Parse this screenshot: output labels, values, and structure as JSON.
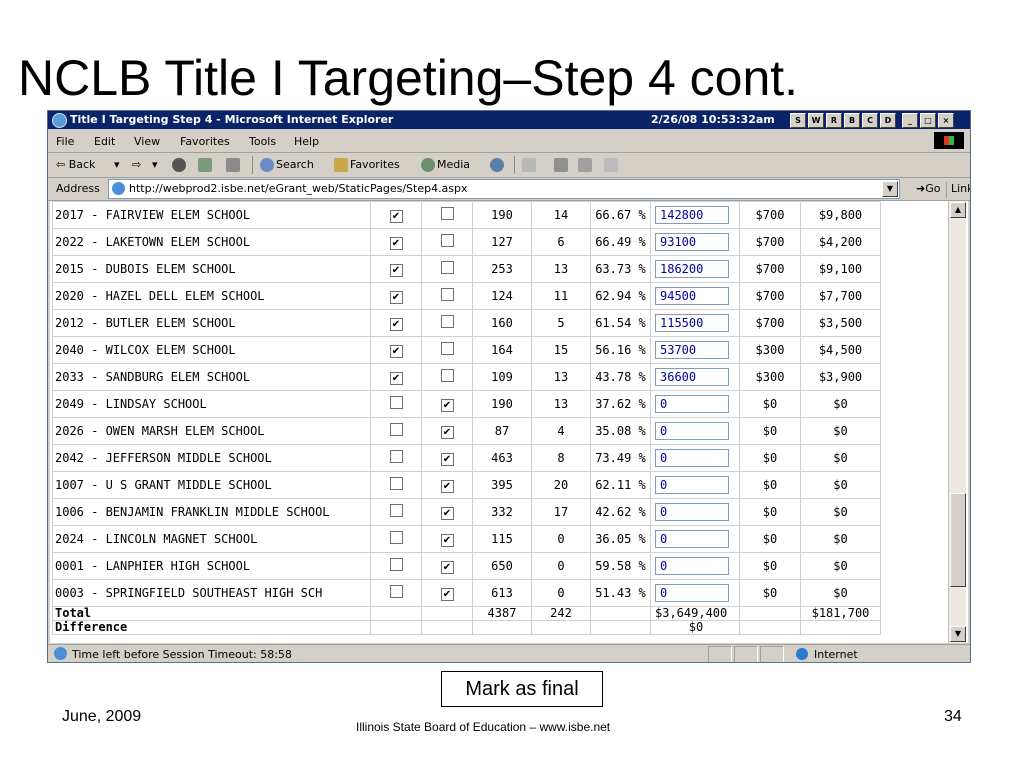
{
  "slide": {
    "title": "NCLB Title I Targeting–Step 4 cont.",
    "mark_button": "Mark as final",
    "footer_date": "June, 2009",
    "footer_center": "Illinois State Board of Education – www.isbe.net",
    "page_number": "34"
  },
  "browser": {
    "window_title": "Title I Targeting Step 4 - Microsoft Internet Explorer",
    "title_stamp": "2/26/08 10:53:32am",
    "title_letters": [
      "S",
      "W",
      "R",
      "B",
      "C",
      "D"
    ],
    "window_controls": [
      "_",
      "□",
      "×"
    ],
    "menu": [
      "File",
      "Edit",
      "View",
      "Favorites",
      "Tools",
      "Help"
    ],
    "toolbar": {
      "back": "⇦ Back",
      "back_dd": "▾",
      "forward": "⇨",
      "forward_dd": "▾",
      "search": "Search",
      "favorites": "Favorites",
      "media": "Media"
    },
    "address_label": "Address",
    "url": "http://webprod2.isbe.net/eGrant_web/StaticPages/Step4.aspx",
    "go_label": "Go",
    "links_label": "Links",
    "links_chevron": "»",
    "status_text": "Time left before Session Timeout: 58:58",
    "zone_label": "Internet"
  },
  "table": {
    "rows": [
      {
        "school": "2017 - FAIRVIEW ELEM SCHOOL",
        "cb1": true,
        "cb2": false,
        "n1": "190",
        "n2": "14",
        "pct": "66.67 %",
        "amount": "142800",
        "rate": "$700",
        "total": "$9,800"
      },
      {
        "school": "2022 - LAKETOWN ELEM SCHOOL",
        "cb1": true,
        "cb2": false,
        "n1": "127",
        "n2": "6",
        "pct": "66.49 %",
        "amount": "93100",
        "rate": "$700",
        "total": "$4,200"
      },
      {
        "school": "2015 - DUBOIS ELEM SCHOOL",
        "cb1": true,
        "cb2": false,
        "n1": "253",
        "n2": "13",
        "pct": "63.73 %",
        "amount": "186200",
        "rate": "$700",
        "total": "$9,100"
      },
      {
        "school": "2020 - HAZEL DELL ELEM SCHOOL",
        "cb1": true,
        "cb2": false,
        "n1": "124",
        "n2": "11",
        "pct": "62.94 %",
        "amount": "94500",
        "rate": "$700",
        "total": "$7,700"
      },
      {
        "school": "2012 - BUTLER ELEM SCHOOL",
        "cb1": true,
        "cb2": false,
        "n1": "160",
        "n2": "5",
        "pct": "61.54 %",
        "amount": "115500",
        "rate": "$700",
        "total": "$3,500"
      },
      {
        "school": "2040 - WILCOX ELEM SCHOOL",
        "cb1": true,
        "cb2": false,
        "n1": "164",
        "n2": "15",
        "pct": "56.16 %",
        "amount": "53700",
        "rate": "$300",
        "total": "$4,500"
      },
      {
        "school": "2033 - SANDBURG ELEM SCHOOL",
        "cb1": true,
        "cb2": false,
        "n1": "109",
        "n2": "13",
        "pct": "43.78 %",
        "amount": "36600",
        "rate": "$300",
        "total": "$3,900"
      },
      {
        "school": "2049 - LINDSAY SCHOOL",
        "cb1": false,
        "cb2": true,
        "n1": "190",
        "n2": "13",
        "pct": "37.62 %",
        "amount": "0",
        "rate": "$0",
        "total": "$0"
      },
      {
        "school": "2026 - OWEN MARSH ELEM SCHOOL",
        "cb1": false,
        "cb2": true,
        "n1": "87",
        "n2": "4",
        "pct": "35.08 %",
        "amount": "0",
        "rate": "$0",
        "total": "$0"
      },
      {
        "school": "2042 - JEFFERSON MIDDLE SCHOOL",
        "cb1": false,
        "cb2": true,
        "n1": "463",
        "n2": "8",
        "pct": "73.49 %",
        "amount": "0",
        "rate": "$0",
        "total": "$0"
      },
      {
        "school": "1007 - U S GRANT MIDDLE SCHOOL",
        "cb1": false,
        "cb2": true,
        "n1": "395",
        "n2": "20",
        "pct": "62.11 %",
        "amount": "0",
        "rate": "$0",
        "total": "$0"
      },
      {
        "school": "1006 - BENJAMIN FRANKLIN MIDDLE SCHOOL",
        "cb1": false,
        "cb2": true,
        "n1": "332",
        "n2": "17",
        "pct": "42.62 %",
        "amount": "0",
        "rate": "$0",
        "total": "$0"
      },
      {
        "school": "2024 - LINCOLN MAGNET SCHOOL",
        "cb1": false,
        "cb2": true,
        "n1": "115",
        "n2": "0",
        "pct": "36.05 %",
        "amount": "0",
        "rate": "$0",
        "total": "$0"
      },
      {
        "school": "0001 - LANPHIER HIGH SCHOOL",
        "cb1": false,
        "cb2": true,
        "n1": "650",
        "n2": "0",
        "pct": "59.58 %",
        "amount": "0",
        "rate": "$0",
        "total": "$0"
      },
      {
        "school": "0003 - SPRINGFIELD SOUTHEAST HIGH SCH",
        "cb1": false,
        "cb2": true,
        "n1": "613",
        "n2": "0",
        "pct": "51.43 %",
        "amount": "0",
        "rate": "$0",
        "total": "$0"
      }
    ],
    "total_row": {
      "label": "Total",
      "n1": "4387",
      "n2": "242",
      "amount": "$3,649,400",
      "total": "$181,700"
    },
    "difference_row": {
      "label": "Difference",
      "amount": "$0"
    },
    "check_glyph": "✔"
  },
  "icons": {
    "browser": "ie-icon",
    "back": "back-arrow-icon",
    "stop": "stop-icon",
    "refresh": "refresh-icon",
    "home": "home-icon",
    "search": "search-icon",
    "favorites": "favorites-icon",
    "media": "media-icon",
    "history": "history-icon",
    "mail": "mail-icon",
    "print": "print-icon",
    "edit": "edit-icon",
    "discuss": "discuss-icon",
    "go": "go-arrow-icon",
    "zone": "internet-zone-icon"
  },
  "colors": {
    "titlebar": "#0a246a",
    "chrome": "#d4d0c8",
    "input_text": "#0000a0"
  }
}
